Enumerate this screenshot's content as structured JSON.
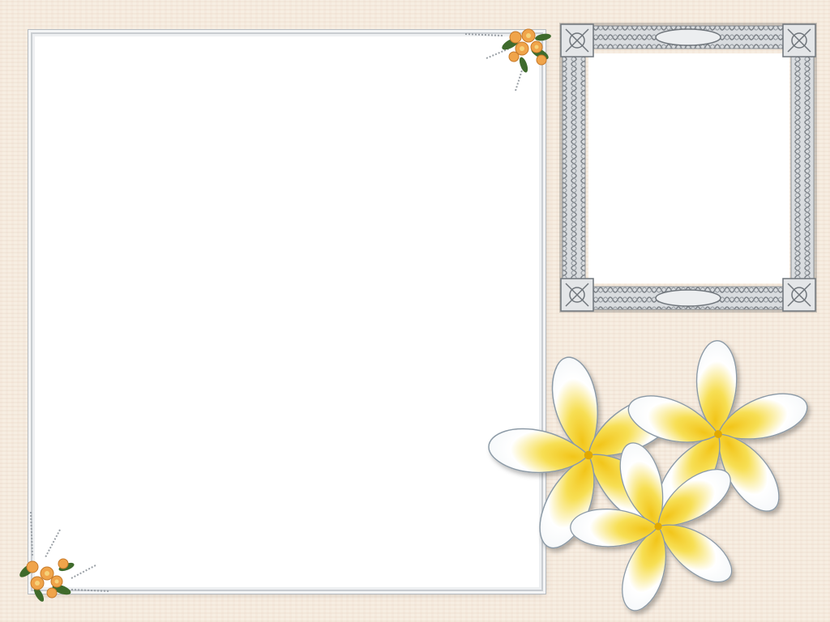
{
  "scene": {
    "description_tags": [
      "photo-template",
      "frangipani-flowers",
      "celtic-frame"
    ],
    "colors": {
      "background": "#f7ece0",
      "frame_silver": "#b9bec3",
      "petal_white": "#ffffff",
      "petal_yellow": "#f2cf1a",
      "rose_orange": "#f0a44a",
      "leaf_green": "#3f6b2c"
    },
    "elements": {
      "large_frame": "white-photo-frame",
      "small_frame": "celtic-knot-frame",
      "flowers": [
        "plumeria-flower",
        "plumeria-flower",
        "plumeria-flower"
      ],
      "corner_bouquets": [
        "rose-bouquet",
        "rose-bouquet"
      ]
    }
  }
}
